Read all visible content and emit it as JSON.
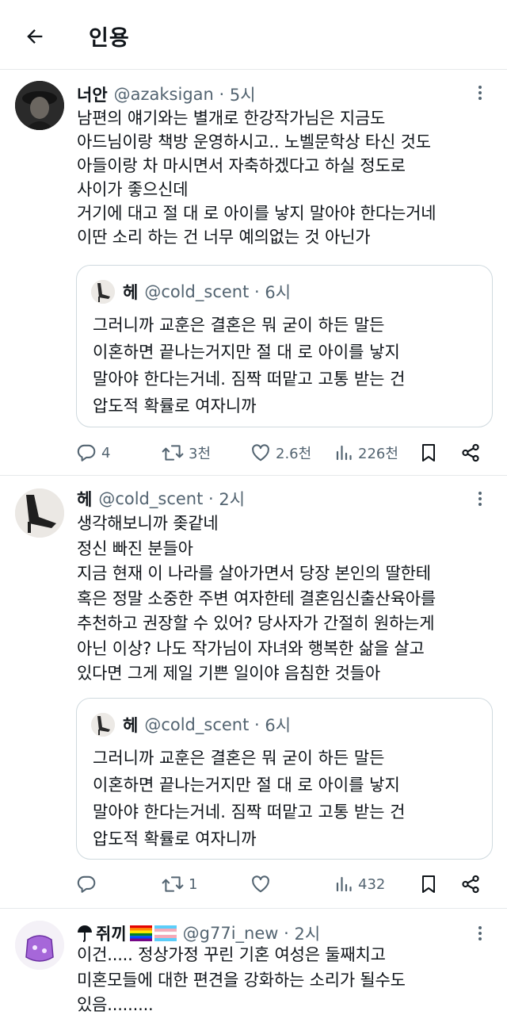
{
  "header": {
    "title": "인용"
  },
  "tweets": [
    {
      "name": "너안",
      "handle": "@azaksigan",
      "time": "5시",
      "body": "남편의 얘기와는 별개로 한강작가님은 지금도\n아드님이랑 책방 운영하시고.. 노벨문학상 타신 것도\n아들이랑 차 마시면서 자축하겠다고 하실 정도로\n사이가 좋으신데\n거기에 대고 절 대 로 아이를 낳지 말아야 한다는거네\n이딴 소리 하는 건 너무 예의없는 것 아닌가",
      "quote": {
        "name": "헤",
        "handle": "@cold_scent",
        "time": "6시",
        "body": "그러니까 교훈은 결혼은 뭐 굳이 하든 말든\n이혼하면 끝나는거지만 절 대 로 아이를 낳지\n말아야 한다는거네. 짐짝 떠맡고 고통 받는 건\n압도적 확률로 여자니까"
      },
      "stats": {
        "replies": "4",
        "retweets": "3천",
        "likes": "2.6천",
        "views": "226천"
      }
    },
    {
      "name": "헤",
      "handle": "@cold_scent",
      "time": "2시",
      "body": "생각해보니까 좆같네\n정신 빠진 분들아\n지금 현재 이 나라를 살아가면서 당장 본인의 딸한테\n혹은 정말 소중한 주변 여자한테 결혼임신출산육아를\n추천하고 권장할 수 있어? 당사자가 간절히 원하는게\n아닌 이상? 나도 작가님이 자녀와 행복한 삶을 살고\n있다면 그게 제일 기쁜 일이야 음침한 것들아",
      "quote": {
        "name": "헤",
        "handle": "@cold_scent",
        "time": "6시",
        "body": "그러니까 교훈은 결혼은 뭐 굳이 하든 말든\n이혼하면 끝나는거지만 절 대 로 아이를 낳지\n말아야 한다는거네. 짐짝 떠맡고 고통 받는 건\n압도적 확률로 여자니까"
      },
      "stats": {
        "replies": "",
        "retweets": "1",
        "likes": "",
        "views": "432"
      }
    },
    {
      "name": "쥐끼",
      "handle": "@g77i_new",
      "time": "2시",
      "body": "이건..... 정상가정 꾸린 기혼 여성은 둘째치고\n미혼모들에 대한 편견을 강화하는 소리가 될수도\n있음........."
    }
  ],
  "colors": {
    "text": "#0f1419",
    "secondary": "#536471",
    "border": "#cfd9de"
  },
  "icons": [
    "back-arrow-icon",
    "more-dots-icon",
    "reply-icon",
    "retweet-icon",
    "like-icon",
    "views-icon",
    "bookmark-icon",
    "share-icon",
    "umbrella-icon",
    "rainbow-flag-icon",
    "trans-flag-icon"
  ]
}
